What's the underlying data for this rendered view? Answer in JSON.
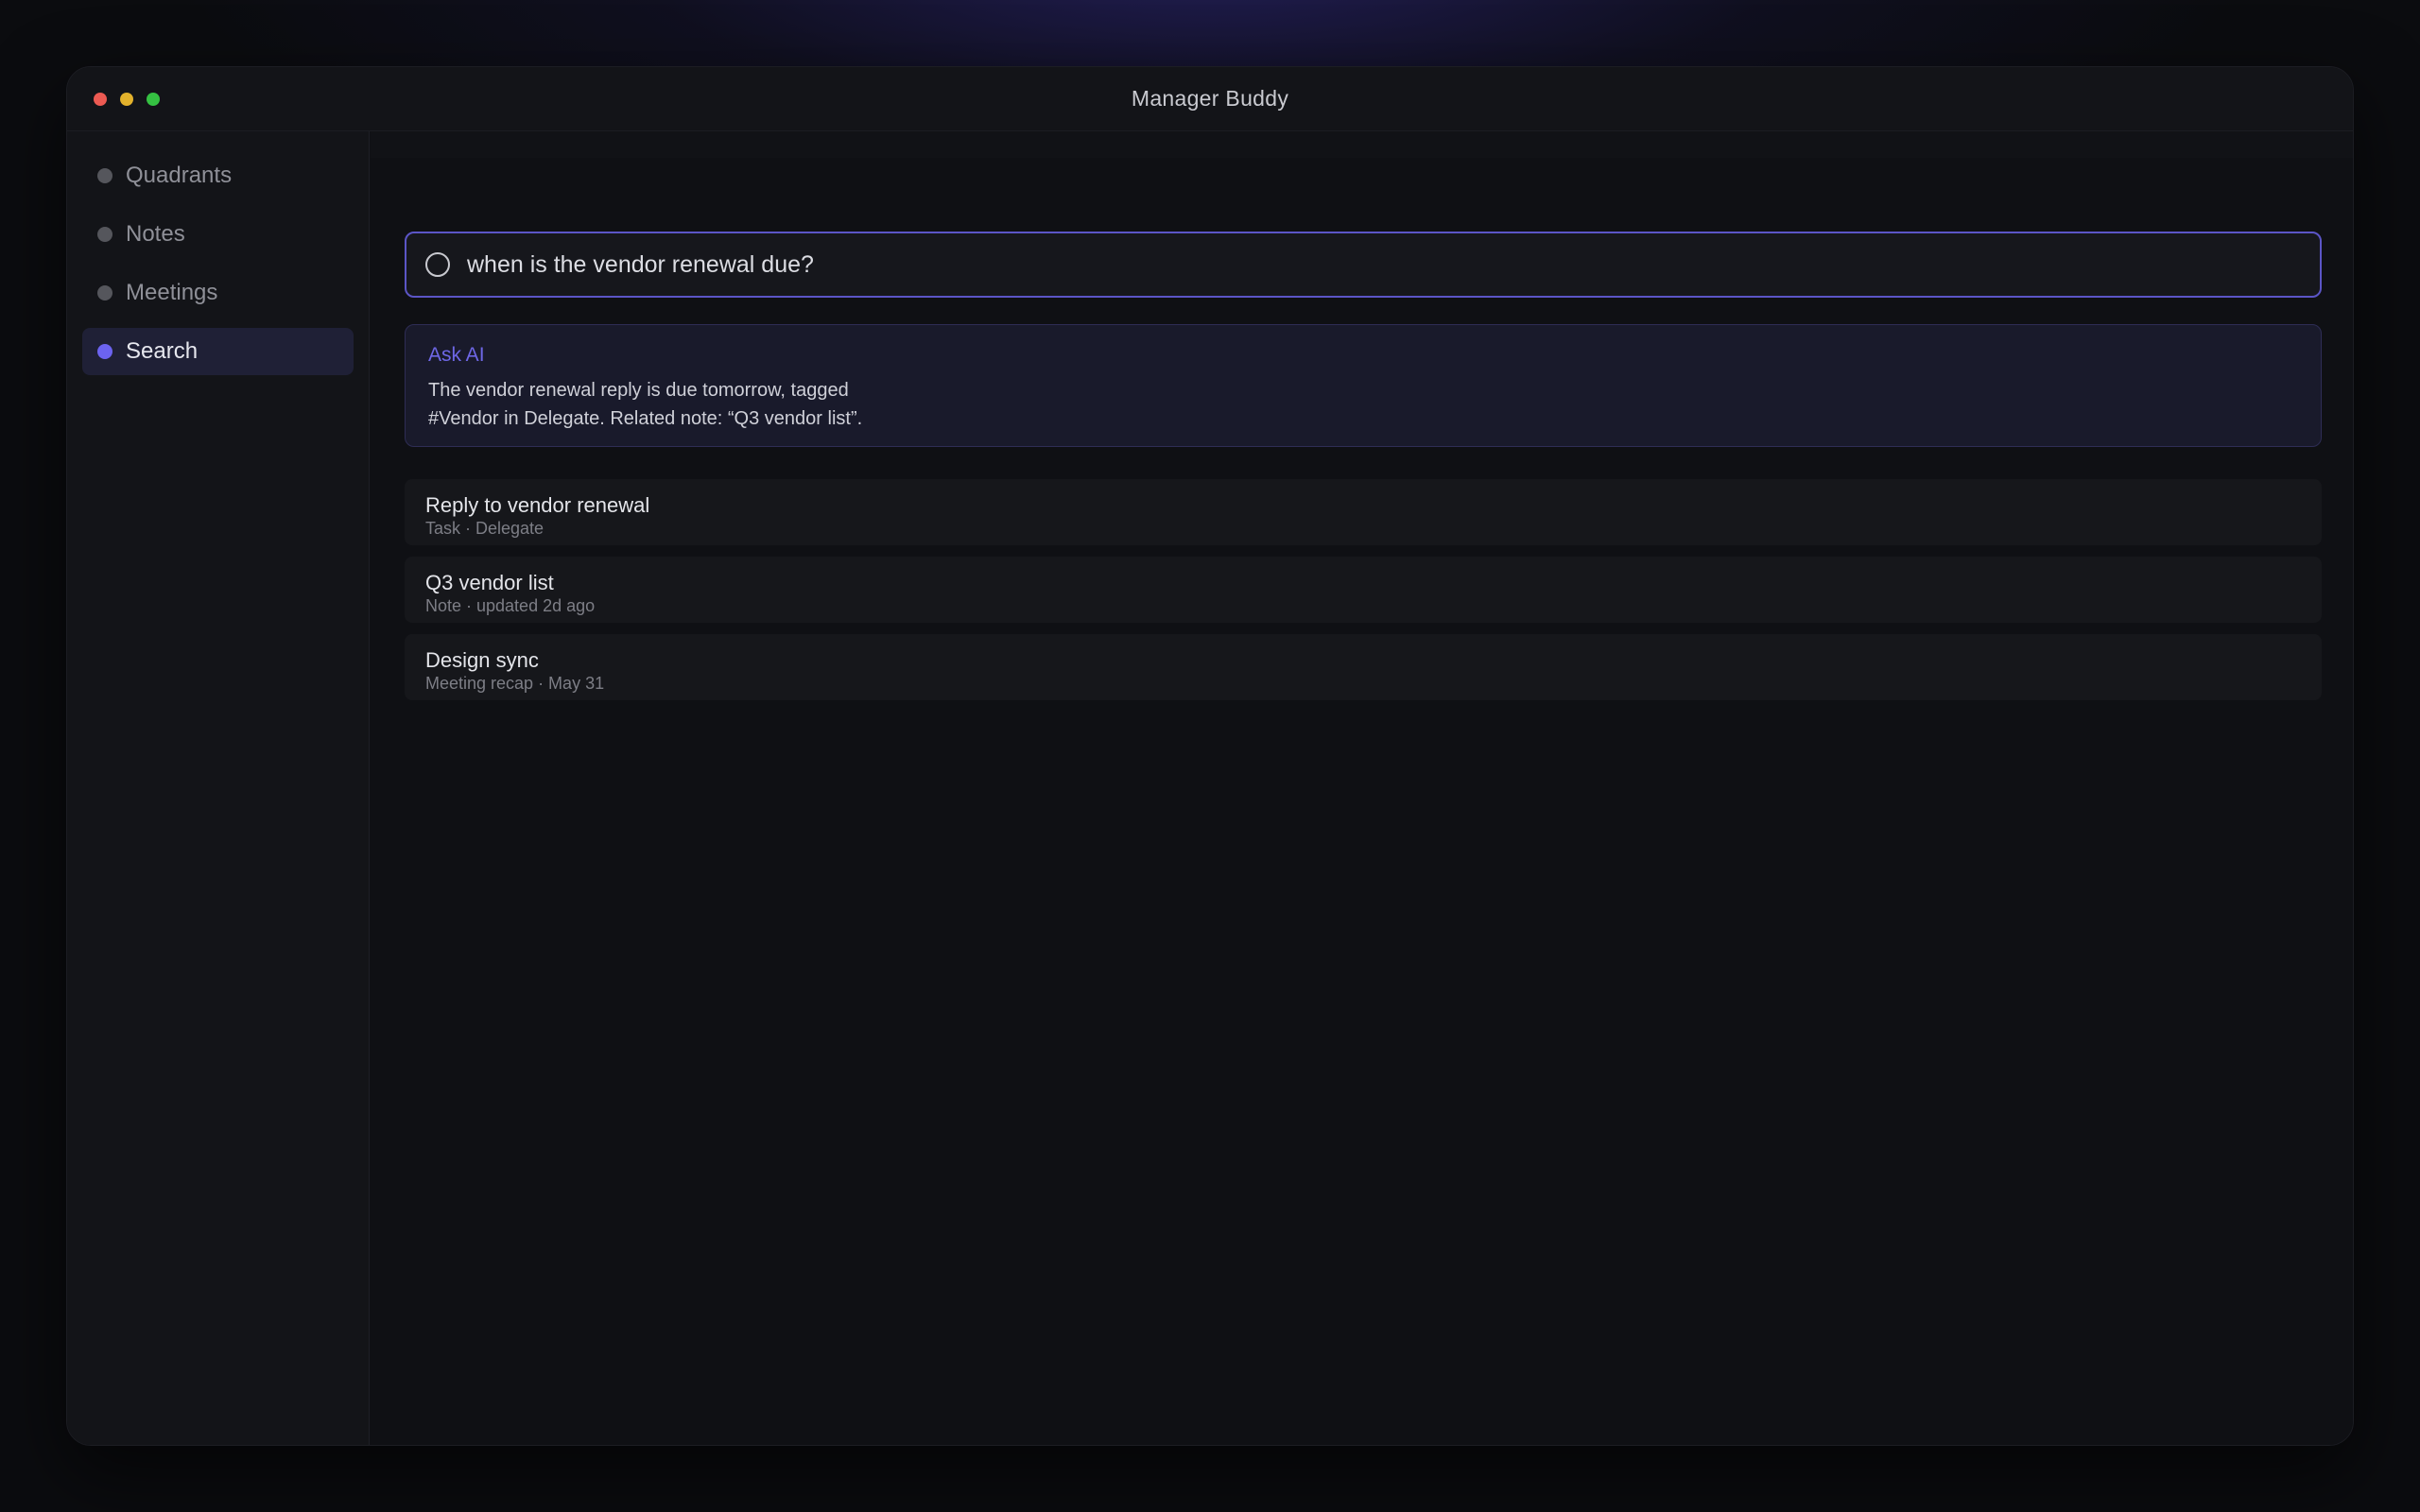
{
  "app": {
    "title": "Manager Buddy"
  },
  "sidebar": {
    "items": [
      {
        "label": "Quadrants",
        "active": false
      },
      {
        "label": "Notes",
        "active": false
      },
      {
        "label": "Meetings",
        "active": false
      },
      {
        "label": "Search",
        "active": true
      }
    ]
  },
  "search": {
    "query": "when is the vendor renewal due?"
  },
  "ai_answer": {
    "label": "Ask AI",
    "line1": "The vendor renewal reply is due tomorrow, tagged",
    "line2": "#Vendor in Delegate. Related note: “Q3 vendor list”."
  },
  "results": [
    {
      "title": "Reply to vendor renewal",
      "meta": "Task · Delegate"
    },
    {
      "title": "Q3 vendor list",
      "meta": "Note · updated 2d ago"
    },
    {
      "title": "Design sync",
      "meta": "Meeting recap · May 31"
    }
  ],
  "colors": {
    "accent": "#6c63f0",
    "background": "#0f1014",
    "sidebar": "#131418"
  }
}
